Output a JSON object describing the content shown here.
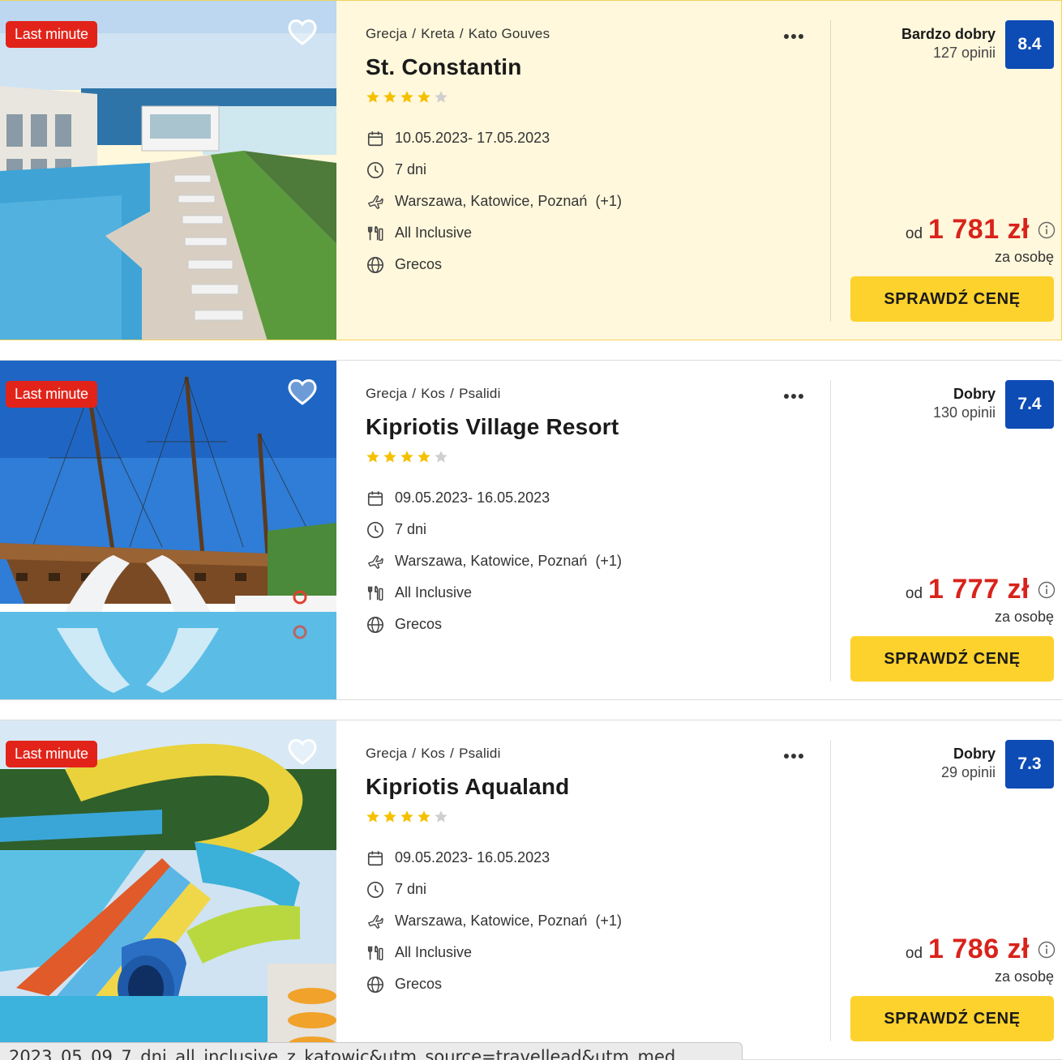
{
  "colors": {
    "badge": "#e2231a",
    "price": "#d8231b",
    "score": "#0d4bb5",
    "cta": "#fdd22c",
    "star": "#f5c000",
    "highlight_bg": "#fff8dc"
  },
  "offers": [
    {
      "badge": "Last minute",
      "favorite_icon": "heart-outline-icon",
      "breadcrumb": [
        "Grecja",
        "Kreta",
        "Kato Gouves"
      ],
      "name": "St. Constantin",
      "stars": 4,
      "dates": "10.05.2023- 17.05.2023",
      "duration": "7 dni",
      "departures": "Warszawa, Katowice, Poznań",
      "departures_more": "(+1)",
      "board": "All Inclusive",
      "operator": "Grecos",
      "rating_label": "Bardzo dobry",
      "reviews": "127 opinii",
      "score": "8.4",
      "price_prefix": "od",
      "price": "1 781 zł",
      "price_note": "za osobę",
      "cta": "SPRAWDŹ CENĘ"
    },
    {
      "badge": "Last minute",
      "favorite_icon": "heart-outline-icon",
      "breadcrumb": [
        "Grecja",
        "Kos",
        "Psalidi"
      ],
      "name": "Kipriotis Village Resort",
      "stars": 4,
      "dates": "09.05.2023- 16.05.2023",
      "duration": "7 dni",
      "departures": "Warszawa, Katowice, Poznań",
      "departures_more": "(+1)",
      "board": "All Inclusive",
      "operator": "Grecos",
      "rating_label": "Dobry",
      "reviews": "130 opinii",
      "score": "7.4",
      "price_prefix": "od",
      "price": "1 777 zł",
      "price_note": "za osobę",
      "cta": "SPRAWDŹ CENĘ"
    },
    {
      "badge": "Last minute",
      "favorite_icon": "heart-outline-icon",
      "breadcrumb": [
        "Grecja",
        "Kos",
        "Psalidi"
      ],
      "name": "Kipriotis Aqualand",
      "stars": 4,
      "dates": "09.05.2023- 16.05.2023",
      "duration": "7 dni",
      "departures": "Warszawa, Katowice, Poznań",
      "departures_more": "(+1)",
      "board": "All Inclusive",
      "operator": "Grecos",
      "rating_label": "Dobry",
      "reviews": "29 opinii",
      "score": "7.3",
      "price_prefix": "od",
      "price": "1 786 zł",
      "price_note": "za osobę",
      "cta": "SPRAWDŹ CENĘ"
    }
  ],
  "status_bar": "2023_05_09_7_dni_all_inclusive_z_katowic&utm_source=travellead&utm_med"
}
